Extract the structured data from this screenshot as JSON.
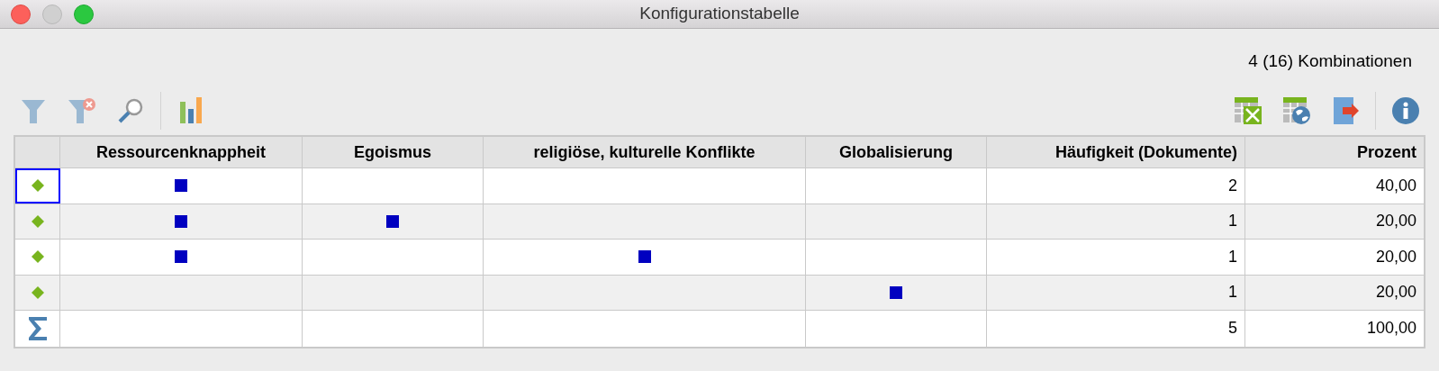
{
  "window": {
    "title": "Konfigurationstabelle"
  },
  "summary": "4 (16) Kombinationen",
  "table": {
    "columns": [
      "Ressourcenknappheit",
      "Egoismus",
      "religiöse, kulturelle Konflikte",
      "Globalisierung",
      "Häufigkeit (Dokumente)",
      "Prozent"
    ],
    "rows": [
      {
        "kind": "combination",
        "selected": true,
        "marks": [
          true,
          false,
          false,
          false
        ],
        "frequency": "2",
        "percent": "40,00"
      },
      {
        "kind": "combination",
        "selected": false,
        "marks": [
          true,
          true,
          false,
          false
        ],
        "frequency": "1",
        "percent": "20,00"
      },
      {
        "kind": "combination",
        "selected": false,
        "marks": [
          true,
          false,
          true,
          false
        ],
        "frequency": "1",
        "percent": "20,00"
      },
      {
        "kind": "combination",
        "selected": false,
        "marks": [
          false,
          false,
          false,
          true
        ],
        "frequency": "1",
        "percent": "20,00"
      },
      {
        "kind": "total",
        "selected": false,
        "marks": [
          false,
          false,
          false,
          false
        ],
        "frequency": "5",
        "percent": "100,00"
      }
    ]
  }
}
